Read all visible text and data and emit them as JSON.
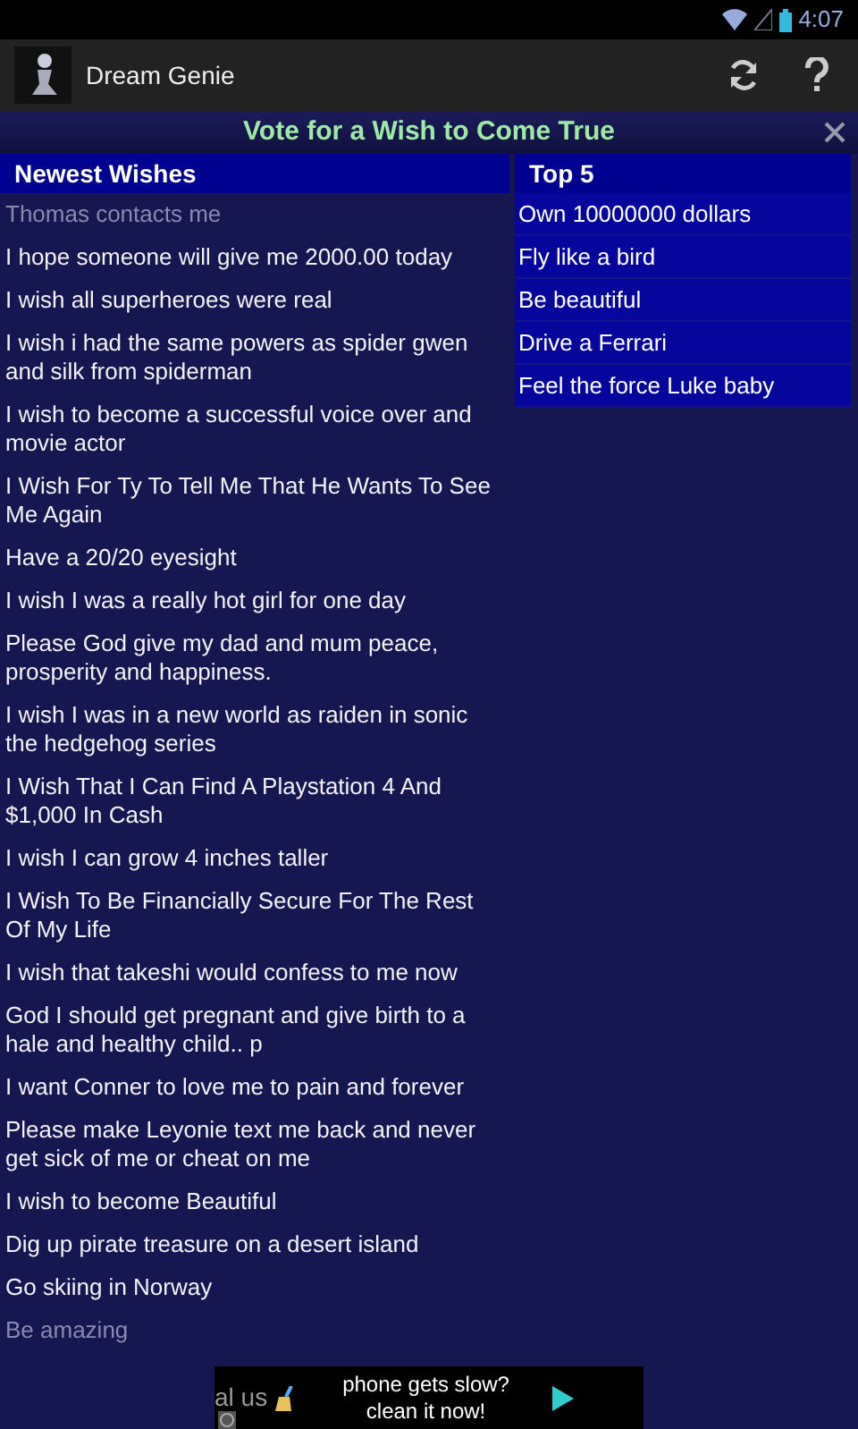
{
  "status_bar": {
    "time": "4:07"
  },
  "app_bar": {
    "title": "Dream Genie"
  },
  "banner": {
    "title": "Vote for a Wish to Come True"
  },
  "newest": {
    "heading": "Newest Wishes",
    "items": [
      {
        "text": "Thomas contacts me",
        "faded": true
      },
      {
        "text": "I hope someone will give me 2000.00 today",
        "faded": false
      },
      {
        "text": "I wish all superheroes were real",
        "faded": false
      },
      {
        "text": "I wish i had the same powers as spider gwen and silk from spiderman",
        "faded": false
      },
      {
        "text": "I wish to become a successful voice over and movie actor",
        "faded": false
      },
      {
        "text": "I Wish For Ty To Tell Me That He Wants To See Me Again",
        "faded": false
      },
      {
        "text": "Have a 20/20 eyesight",
        "faded": false
      },
      {
        "text": "I wish I was a really hot girl for one day",
        "faded": false
      },
      {
        "text": "Please God give my dad and mum peace, prosperity and happiness.",
        "faded": false
      },
      {
        "text": "I wish I was in a new world as raiden in sonic the hedgehog series",
        "faded": false
      },
      {
        "text": "I Wish That I Can Find A Playstation 4 And $1,000 In Cash",
        "faded": false
      },
      {
        "text": "I wish I can grow 4 inches taller",
        "faded": false
      },
      {
        "text": "I Wish To Be Financially Secure For The Rest Of My Life",
        "faded": false
      },
      {
        "text": "I wish that takeshi would confess to me now",
        "faded": false
      },
      {
        "text": "God I should get pregnant and give birth to a hale and healthy child.. p",
        "faded": false
      },
      {
        "text": "I want Conner to love me to pain and forever",
        "faded": false
      },
      {
        "text": "Please make Leyonie text me back and never get sick of me or cheat on me",
        "faded": false
      },
      {
        "text": "I wish to become Beautiful",
        "faded": false
      },
      {
        "text": "Dig up pirate treasure on a desert island",
        "faded": false
      },
      {
        "text": "Go skiing in Norway",
        "faded": false
      },
      {
        "text": "Be amazing",
        "faded": true
      }
    ]
  },
  "top": {
    "heading": "Top 5",
    "items": [
      "Own 10000000 dollars",
      "Fly like a bird",
      "Be beautiful",
      "Drive a Ferrari",
      "Feel the force Luke baby"
    ]
  },
  "ad": {
    "brand_fragment": "al us",
    "line_1": "phone gets slow?",
    "line_2": "clean it now!"
  }
}
